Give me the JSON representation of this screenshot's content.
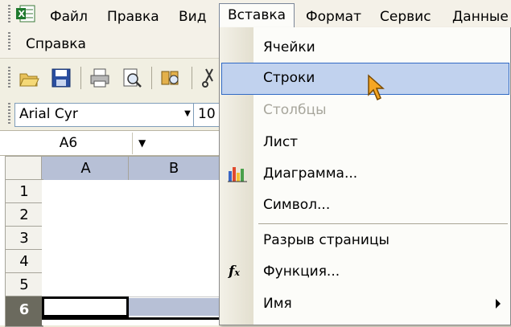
{
  "menubar": {
    "file": "Файл",
    "edit": "Правка",
    "view": "Вид",
    "insert": "Вставка",
    "format": "Формат",
    "tools": "Сервис",
    "data": "Данные",
    "help": "Справка"
  },
  "toolbar": {
    "font_name": "Arial Cyr",
    "font_size": "10"
  },
  "namebox": {
    "value": "A6"
  },
  "grid": {
    "columns": [
      "A",
      "B"
    ],
    "rows": [
      "1",
      "2",
      "3",
      "4",
      "5",
      "6"
    ],
    "selected_row": "6"
  },
  "insert_menu": {
    "items": [
      {
        "label": "Ячейки",
        "state": "normal"
      },
      {
        "label": "Строки",
        "state": "highlighted"
      },
      {
        "label": "Столбцы",
        "state": "disabled"
      },
      {
        "label": "Лист",
        "state": "normal"
      },
      {
        "label": "Диаграмма...",
        "state": "normal",
        "icon": "chart-icon"
      },
      {
        "label": "Символ...",
        "state": "normal"
      },
      {
        "label": "Разрыв страницы",
        "state": "normal"
      },
      {
        "label": "Функция...",
        "state": "normal",
        "icon": "function-icon"
      },
      {
        "label": "Имя",
        "state": "normal",
        "submenu": true
      }
    ]
  },
  "colors": {
    "highlight_bg": "#c1d2ee",
    "highlight_border": "#316ac5",
    "disabled_text": "#a7a69c",
    "selected_row_header": "#6b6a5e",
    "selected_col_header": "#b7c0d6"
  }
}
